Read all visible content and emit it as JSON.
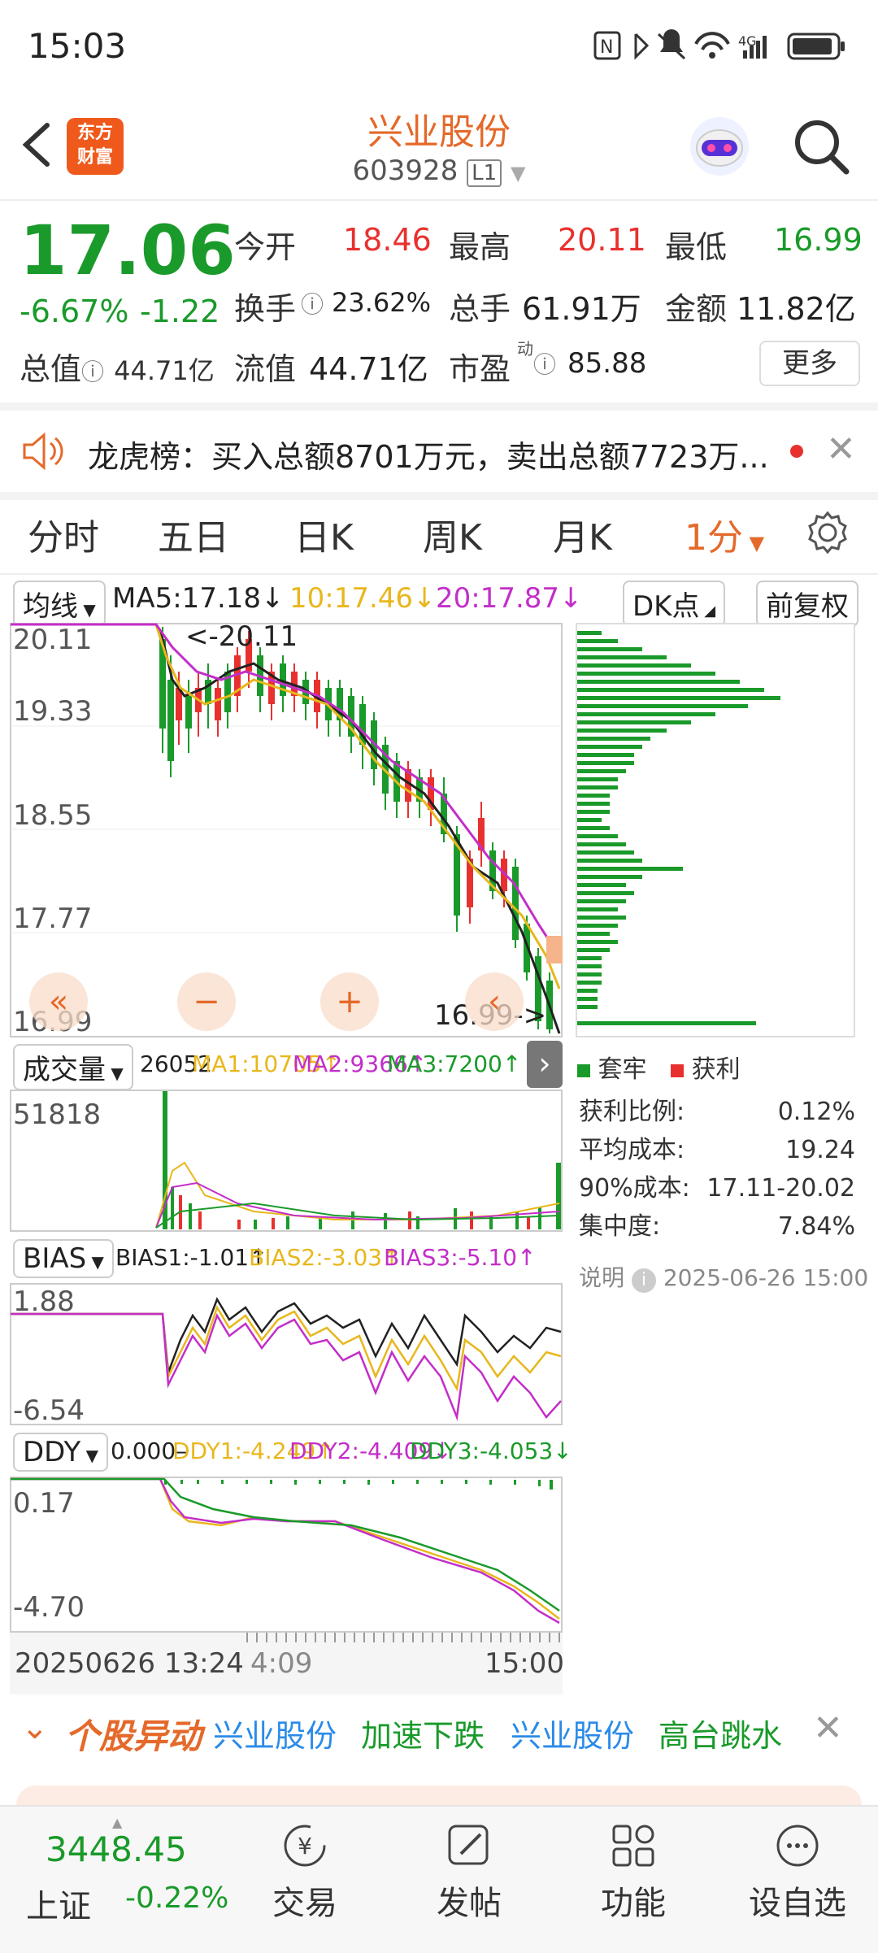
{
  "status": {
    "time": "15:03",
    "network": "4G"
  },
  "nav": {
    "back_icon": "chevron-left-icon",
    "logo_line1": "东方",
    "logo_line2": "财富",
    "title": "兴业股份",
    "code": "603928",
    "level": "L1"
  },
  "quote": {
    "price": "17.06",
    "change_pct": "-6.67%",
    "change_abs": "-1.22",
    "open_label": "今开",
    "open": "18.46",
    "high_label": "最高",
    "high": "20.11",
    "low_label": "最低",
    "low": "16.99",
    "turnover_label": "换手",
    "turnover": "23.62%",
    "volume_label": "总手",
    "volume": "61.91万",
    "amount_label": "金额",
    "amount": "11.82亿",
    "mktcap_label": "总值",
    "mktcap": "44.71亿",
    "float_label": "流值",
    "float": "44.71亿",
    "pe_label": "市盈",
    "pe_sup": "动",
    "pe": "85.88",
    "more_label": "更多"
  },
  "notice": {
    "text": "龙虎榜：买入总额8701万元，卖出总额7723万..."
  },
  "tabs": [
    "分时",
    "五日",
    "日K",
    "周K",
    "月K",
    "1分"
  ],
  "chart_controls": {
    "ma_select": "均线",
    "ma5": "MA5:17.18↓",
    "ma10": "10:17.46↓",
    "ma20": "20:17.87↓",
    "dk_select": "DK点",
    "adjust_btn": "前复权",
    "y_labels": [
      "20.11",
      "19.33",
      "18.55",
      "17.77",
      "16.99"
    ],
    "high_marker": "<-20.11",
    "low_marker": "16.99->",
    "vol_select": "成交量",
    "vol_value": "26052",
    "vol_ma1": "MA1:10705↑",
    "vol_ma2": "MA2:9366↑",
    "vol_ma3": "MA3:7200↑",
    "vol_max": "51818",
    "bias_select": "BIAS",
    "bias1": "BIAS1:-1.01↑",
    "bias2": "BIAS2:-3.03↑",
    "bias3": "BIAS3:-5.10↑",
    "bias_top": "1.88",
    "bias_bottom": "-6.54",
    "ddy_select": "DDY",
    "ddy_value": "0.000–",
    "ddy1": "DDY1:-4.249↑",
    "ddy2": "DDY2:-4.409↓",
    "ddy3": "DDY3:-4.053↓",
    "ddy_top": "0.17",
    "ddy_bottom": "-4.70",
    "x_start": "20250626 13:24",
    "x_mid": "4:09",
    "x_end": "15:00"
  },
  "chip_panel": {
    "legend_trapped": "套牢",
    "legend_profit": "获利",
    "rows": [
      {
        "label": "获利比例:",
        "value": "0.12%"
      },
      {
        "label": "平均成本:",
        "value": "19.24"
      },
      {
        "label": "90%成本:",
        "value": "17.11-20.02"
      },
      {
        "label": "集中度:",
        "value": "7.84%"
      }
    ],
    "note_label": "说明",
    "note_time": "2025-06-26 15:00"
  },
  "alert": {
    "title": "个股异动",
    "items": [
      "兴业股份",
      "加速下跌",
      "兴业股份",
      "高台跳水"
    ]
  },
  "bottom_nav": {
    "index_value": "3448.45",
    "index_name": "上证",
    "index_change": "-0.22%",
    "items": [
      "交易",
      "发帖",
      "功能",
      "设自选"
    ]
  },
  "colors": {
    "accent": "#e4692a",
    "up": "#e8312f",
    "down": "#1a9a2a"
  }
}
